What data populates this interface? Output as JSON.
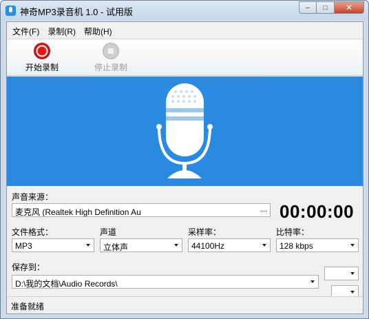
{
  "window": {
    "title": "神奇MP3录音机 1.0 - 试用版"
  },
  "menu": {
    "items": [
      "文件(F)",
      "录制(R)",
      "帮助(H)"
    ]
  },
  "toolbar": {
    "start_label": "开始录制",
    "stop_label": "停止录制"
  },
  "banner": {
    "color": "#2a8ae0",
    "icon": "microphone-icon"
  },
  "source": {
    "label": "声音来源：",
    "value": "麦克风 (Realtek High Definition Au",
    "browse": "..."
  },
  "timer": {
    "value": "00:00:00"
  },
  "format": {
    "label": "文件格式：",
    "value": "MP3"
  },
  "channel": {
    "label": "声道",
    "value": "立体声"
  },
  "samplerate": {
    "label": "采样率：",
    "value": "44100Hz"
  },
  "bitrate": {
    "label": "比特率：",
    "value": "128 kbps"
  },
  "save": {
    "label": "保存到：",
    "value": "D:\\我的文档\\Audio Records\\"
  },
  "status": {
    "text": "准备就绪"
  }
}
